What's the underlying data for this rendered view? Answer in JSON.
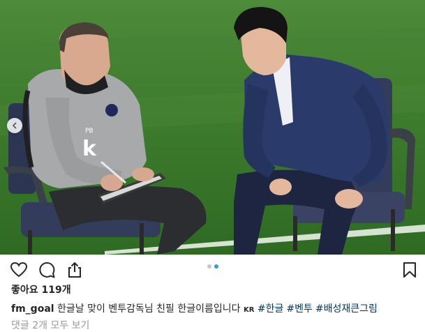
{
  "post": {
    "likes_label": "좋아요",
    "likes_count": "119개",
    "username": "fm_goal",
    "caption_text": "한글날 맞이 벤투감독님 친필 한글이름입니다",
    "caption_flag": "KR",
    "hashtags": [
      "#한글",
      "#벤투",
      "#배성재큰그림"
    ],
    "comments_link": "댓글 2개 모두 보기"
  },
  "photo": {
    "jersey_initials": "PB",
    "jersey_logo": "k"
  },
  "carousel": {
    "total": 2,
    "active": 2
  },
  "colors": {
    "hashtag": "#003569",
    "dot_active": "#3897f0",
    "grass": "#3f7a2e"
  }
}
